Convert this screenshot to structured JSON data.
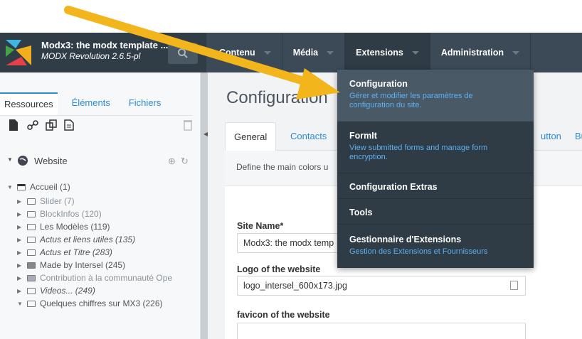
{
  "header": {
    "site_name": "Modx3: the modx template ...",
    "site_version": "MODX Revolution 2.6.5-pl",
    "nav": [
      {
        "label": "Contenu"
      },
      {
        "label": "Média"
      },
      {
        "label": "Extensions"
      },
      {
        "label": "Administration"
      }
    ]
  },
  "left_panel": {
    "tabs": [
      "Ressources",
      "Éléments",
      "Fichiers"
    ],
    "root_label": "Website",
    "tree": [
      {
        "label": "Accueil (1)"
      },
      {
        "label": "Slider (7)"
      },
      {
        "label": "BlockInfos (120)"
      },
      {
        "label": "Les Modèles (119)"
      },
      {
        "label": "Actus et liens utiles (135)"
      },
      {
        "label": "Actus et Titre (283)"
      },
      {
        "label": "Made by Intersel (245)"
      },
      {
        "label": "Contribution à la communauté Ope"
      },
      {
        "label": "Videos... (249)"
      },
      {
        "label": "Quelques chiffres sur MX3 (226)"
      }
    ]
  },
  "main": {
    "title": "Configuration",
    "tabs": [
      "General",
      "Contacts",
      "utton",
      "Bu"
    ],
    "description": "Define the main colors u",
    "fields": {
      "site_name_label": "Site Name*",
      "site_name_value": "Modx3: the modx temp",
      "logo_label": "Logo of the website",
      "logo_value": "logo_intersel_600x173.jpg",
      "favicon_label": "favicon of the website"
    }
  },
  "dropdown": {
    "items": [
      {
        "title": "Configuration",
        "desc": "Gérer et modifier les paramètres de configuration du site."
      },
      {
        "title": "FormIt",
        "desc": "View submitted forms and manage form encryption."
      },
      {
        "title": "Configuration Extras",
        "desc": ""
      },
      {
        "title": "Tools",
        "desc": ""
      },
      {
        "title": "Gestionnaire d'Extensions",
        "desc": "Gestion des Extensions et Fournisseurs"
      }
    ]
  },
  "colors": {
    "topbar": "#3b4a56",
    "dropdown": "#2f3c46",
    "link": "#2a8bd6",
    "arrow": "#f2b51c"
  },
  "icons": [
    "search-icon",
    "new-document-icon",
    "weblink-icon",
    "symlink-icon",
    "static-resource-icon",
    "trash-icon",
    "globe-icon",
    "plus-icon",
    "refresh-icon",
    "folder-icon",
    "image-icon",
    "image-file-icon"
  ]
}
